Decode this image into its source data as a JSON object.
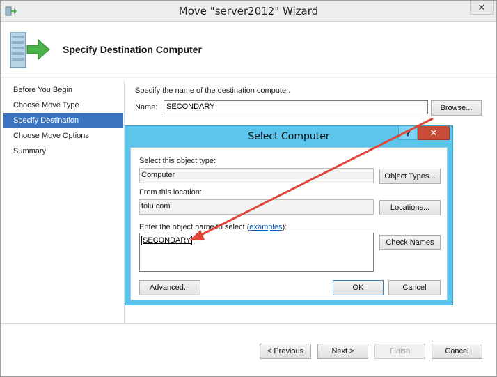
{
  "window": {
    "title": "Move \"server2012\" Wizard",
    "close_glyph": "✕"
  },
  "header": {
    "title": "Specify Destination Computer",
    "icon": "server-move-icon"
  },
  "nav": {
    "items": [
      {
        "label": "Before You Begin",
        "active": false
      },
      {
        "label": "Choose Move Type",
        "active": false
      },
      {
        "label": "Specify Destination",
        "active": true
      },
      {
        "label": "Choose Move Options",
        "active": false
      },
      {
        "label": "Summary",
        "active": false
      }
    ]
  },
  "main": {
    "prompt": "Specify the name of the destination computer.",
    "name_label": "Name:",
    "name_value": "SECONDARY",
    "browse_label": "Browse..."
  },
  "footer": {
    "previous": "< Previous",
    "next": "Next >",
    "finish": "Finish",
    "cancel": "Cancel"
  },
  "dialog": {
    "title": "Select Computer",
    "help_glyph": "?",
    "close_glyph": "✕",
    "object_type_label": "Select this object type:",
    "object_type_value": "Computer",
    "object_types_button": "Object Types...",
    "location_label": "From this location:",
    "location_value": "tolu.com",
    "locations_button": "Locations...",
    "enter_label_prefix": "Enter the object name to select (",
    "enter_label_link": "examples",
    "enter_label_suffix": "):",
    "entered_name": "SECONDARY",
    "check_names_button": "Check Names",
    "advanced_button": "Advanced...",
    "ok_button": "OK",
    "cancel_button": "Cancel"
  },
  "colors": {
    "accent": "#3a73c0",
    "dialog_frame": "#5bc5ec",
    "close_red": "#c74b37",
    "annotation_arrow": "#e0463a"
  }
}
